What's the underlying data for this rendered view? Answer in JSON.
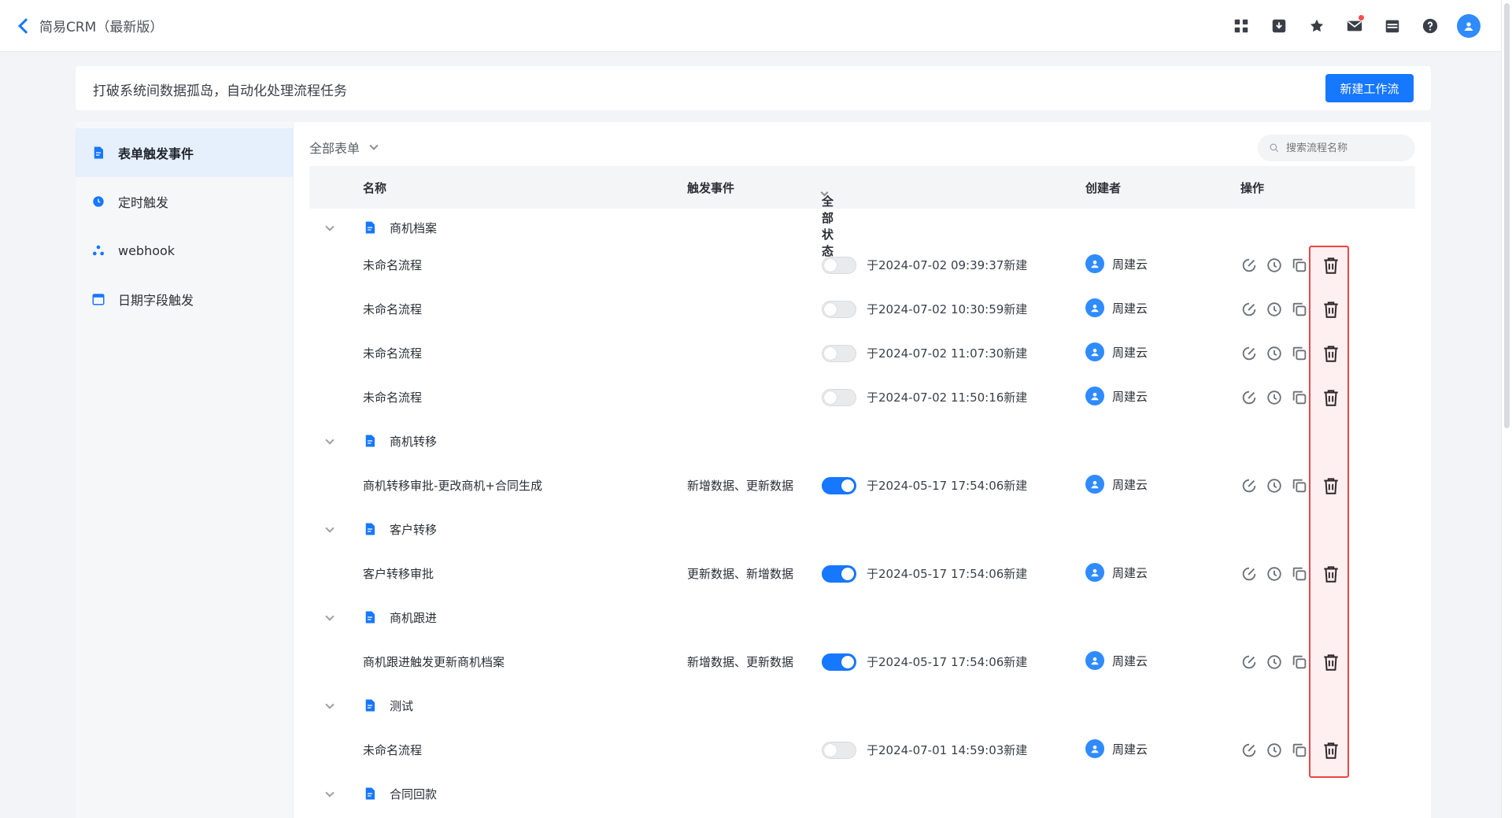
{
  "header": {
    "title": "简易CRM（最新版）",
    "icons": [
      "apps-icon",
      "download-icon",
      "star-icon",
      "message-icon",
      "calendar-icon",
      "help-icon",
      "avatar"
    ]
  },
  "banner": {
    "text": "打破系统间数据孤岛，自动化处理流程任务",
    "new_button": "新建工作流"
  },
  "sidebar": {
    "items": [
      {
        "label": "表单触发事件",
        "icon": "form-icon"
      },
      {
        "label": "定时触发",
        "icon": "clock-icon"
      },
      {
        "label": "webhook",
        "icon": "webhook-icon"
      },
      {
        "label": "日期字段触发",
        "icon": "calendar-icon"
      }
    ]
  },
  "toolbar": {
    "filter": "全部表单",
    "search_placeholder": "搜索流程名称"
  },
  "table": {
    "headers": {
      "name": "名称",
      "trigger": "触发事件",
      "status": "全部状态",
      "creator": "创建者",
      "actions": "操作"
    },
    "groups": [
      {
        "name": "商机档案",
        "rows": [
          {
            "name": "未命名流程",
            "trigger": "",
            "enabled": false,
            "time": "于2024-07-02 09:39:37新建",
            "creator": "周建云"
          },
          {
            "name": "未命名流程",
            "trigger": "",
            "enabled": false,
            "time": "于2024-07-02 10:30:59新建",
            "creator": "周建云"
          },
          {
            "name": "未命名流程",
            "trigger": "",
            "enabled": false,
            "time": "于2024-07-02 11:07:30新建",
            "creator": "周建云"
          },
          {
            "name": "未命名流程",
            "trigger": "",
            "enabled": false,
            "time": "于2024-07-02 11:50:16新建",
            "creator": "周建云"
          }
        ]
      },
      {
        "name": "商机转移",
        "rows": [
          {
            "name": "商机转移审批-更改商机+合同生成",
            "trigger": "新增数据、更新数据",
            "enabled": true,
            "time": "于2024-05-17 17:54:06新建",
            "creator": "周建云"
          }
        ]
      },
      {
        "name": "客户转移",
        "rows": [
          {
            "name": "客户转移审批",
            "trigger": "更新数据、新增数据",
            "enabled": true,
            "time": "于2024-05-17 17:54:06新建",
            "creator": "周建云"
          }
        ]
      },
      {
        "name": "商机跟进",
        "rows": [
          {
            "name": "商机跟进触发更新商机档案",
            "trigger": "新增数据、更新数据",
            "enabled": true,
            "time": "于2024-05-17 17:54:06新建",
            "creator": "周建云"
          }
        ]
      },
      {
        "name": "测试",
        "rows": [
          {
            "name": "未命名流程",
            "trigger": "",
            "enabled": false,
            "time": "于2024-07-01 14:59:03新建",
            "creator": "周建云"
          }
        ]
      },
      {
        "name": "合同回款",
        "rows": []
      }
    ]
  },
  "colors": {
    "accent": "#1677ff",
    "highlight": "#ef4444"
  }
}
